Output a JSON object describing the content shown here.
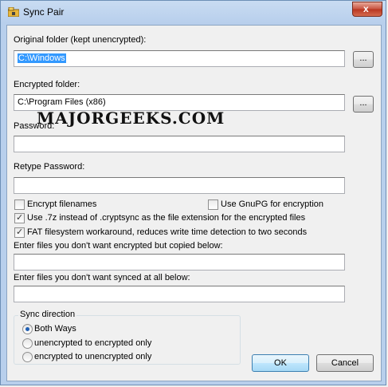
{
  "window": {
    "title": "Sync Pair",
    "close_label": "x"
  },
  "original": {
    "label": "Original folder (kept unencrypted):",
    "value": "C:\\Windows",
    "browse_label": "..."
  },
  "encrypted": {
    "label": "Encrypted folder:",
    "value": "C:\\Program Files (x86)",
    "browse_label": "..."
  },
  "password": {
    "label": "Password:",
    "value": ""
  },
  "watermark": "MAJORGEEKS.COM",
  "retype": {
    "label": "Retype Password:",
    "value": ""
  },
  "options": {
    "encrypt_filenames": {
      "label": "Encrypt filenames",
      "checked": false
    },
    "gnupg": {
      "label": "Use GnuPG for encryption",
      "checked": false
    },
    "use7z": {
      "label": "Use .7z instead of .cryptsync as the file extension for the encrypted files",
      "checked": true
    },
    "fat": {
      "label": "FAT filesystem workaround, reduces write time detection to two seconds",
      "checked": true
    }
  },
  "copied": {
    "label": "Enter files you don't want encrypted but copied below:",
    "value": ""
  },
  "not_synced": {
    "label": "Enter files you don't want synced at all below:",
    "value": ""
  },
  "sync_direction": {
    "title": "Sync direction",
    "options": [
      "Both Ways",
      "unencrypted to encrypted only",
      "encrypted to unencrypted only"
    ],
    "selected": "Both Ways"
  },
  "buttons": {
    "ok": "OK",
    "cancel": "Cancel"
  }
}
